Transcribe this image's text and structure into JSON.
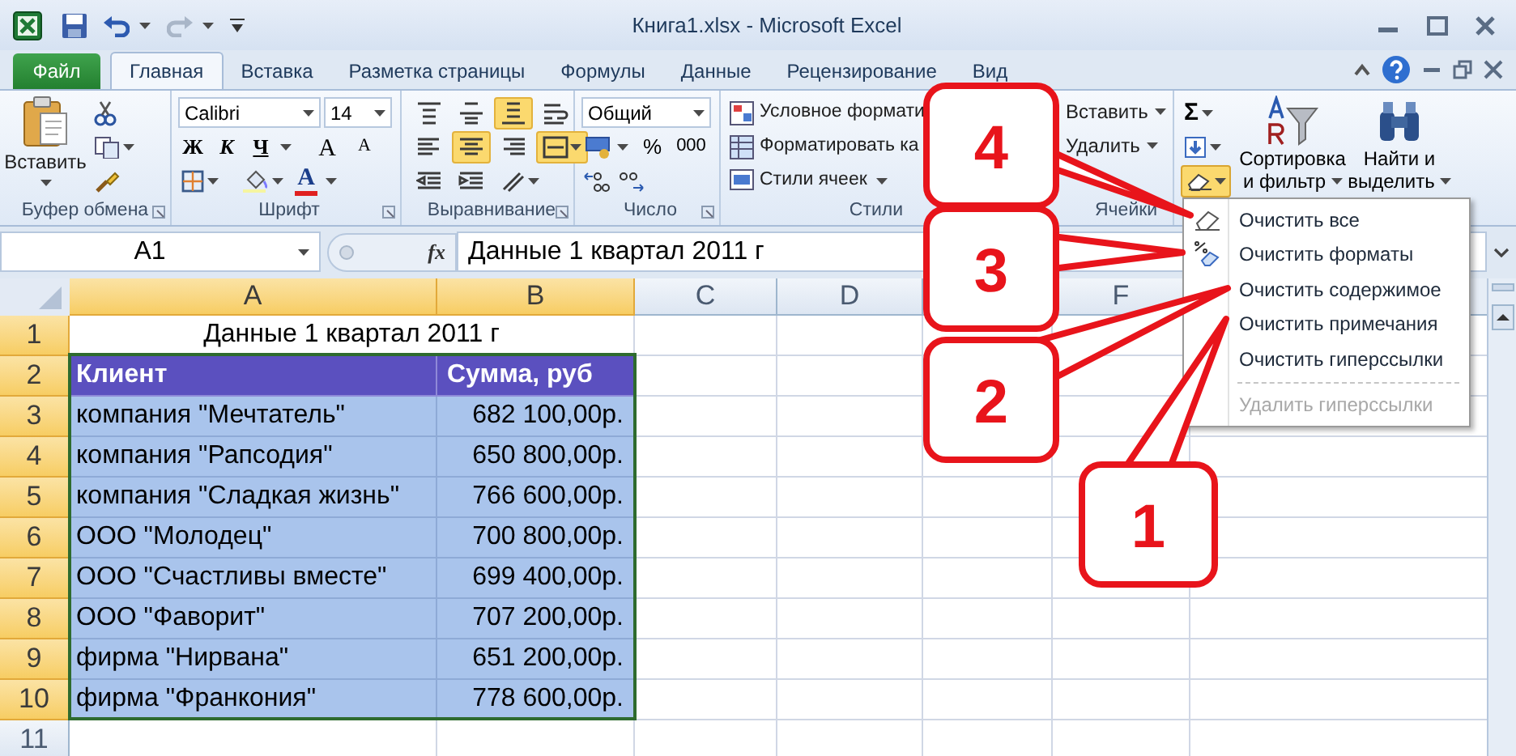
{
  "window": {
    "title": "Книга1.xlsx - Microsoft Excel"
  },
  "tabs": [
    {
      "label": "Файл",
      "kind": "file",
      "selected": false
    },
    {
      "label": "Главная",
      "kind": "tab",
      "selected": true
    },
    {
      "label": "Вставка",
      "kind": "tab",
      "selected": false
    },
    {
      "label": "Разметка страницы",
      "kind": "tab",
      "selected": false
    },
    {
      "label": "Формулы",
      "kind": "tab",
      "selected": false
    },
    {
      "label": "Данные",
      "kind": "tab",
      "selected": false
    },
    {
      "label": "Рецензирование",
      "kind": "tab",
      "selected": false
    },
    {
      "label": "Вид",
      "kind": "tab",
      "selected": false
    }
  ],
  "ribbon": {
    "clipboard": {
      "paste": "Вставить",
      "label": "Буфер обмена"
    },
    "font": {
      "name": "Calibri",
      "size": "14",
      "bold": "Ж",
      "italic": "К",
      "underline": "Ч",
      "grow": "A",
      "shrink": "A",
      "font_color_button": "A",
      "label": "Шрифт"
    },
    "alignment": {
      "label": "Выравнивание",
      "buttons": [
        {
          "kind": "top",
          "selected": false
        },
        {
          "kind": "middle",
          "selected": false
        },
        {
          "kind": "bottom",
          "selected": true
        },
        {
          "kind": "wrap",
          "selected": false
        },
        {
          "kind": "left",
          "selected": false
        },
        {
          "kind": "center",
          "selected": true
        },
        {
          "kind": "right",
          "selected": false
        },
        {
          "kind": "merge",
          "selected": true
        },
        {
          "kind": "outdent",
          "selected": false
        },
        {
          "kind": "indent",
          "selected": false
        },
        {
          "kind": "orientation",
          "selected": false
        }
      ]
    },
    "number": {
      "format": "Общий",
      "percent": "%",
      "thousands": "000",
      "label": "Число"
    },
    "styles": {
      "label": "Стили",
      "items": [
        {
          "label": "Условное формати",
          "menu": false
        },
        {
          "label": "Форматировать ка",
          "menu": false
        },
        {
          "label": "Стили ячеек",
          "menu": true
        }
      ]
    },
    "cells": {
      "label": "Ячейки",
      "items": [
        "Вставить",
        "Удалить"
      ]
    },
    "editing": {
      "sum": "Σ",
      "clear": {
        "expanded": true
      },
      "sort": [
        "Сортировка",
        "и фильтр"
      ],
      "find": [
        "Найти и",
        "выделить"
      ]
    }
  },
  "formula_bar": {
    "name_box": "A1",
    "function_button": "fx",
    "formula": "Данные 1 квартал 2011 г"
  },
  "sheet": {
    "columns": [
      {
        "label": "A",
        "selected": true
      },
      {
        "label": "B",
        "selected": true
      },
      {
        "label": "C",
        "selected": false
      },
      {
        "label": "D",
        "selected": false
      },
      {
        "label": "F",
        "selected": false
      }
    ],
    "row_headers": [
      {
        "label": "1",
        "selected": true
      },
      {
        "label": "2",
        "selected": true
      },
      {
        "label": "3",
        "selected": true
      },
      {
        "label": "4",
        "selected": true
      },
      {
        "label": "5",
        "selected": true
      },
      {
        "label": "6",
        "selected": true
      },
      {
        "label": "7",
        "selected": true
      },
      {
        "label": "8",
        "selected": true
      },
      {
        "label": "9",
        "selected": true
      },
      {
        "label": "10",
        "selected": true
      },
      {
        "label": "11",
        "selected": false
      }
    ],
    "title": "Данные 1 квартал 2011 г",
    "header": [
      "Клиент",
      "Сумма, руб"
    ],
    "rows": [
      [
        "компания \"Мечтатель\"",
        "682 100,00р."
      ],
      [
        "компания \"Рапсодия\"",
        "650 800,00р."
      ],
      [
        "компания \"Сладкая жизнь\"",
        "766 600,00р."
      ],
      [
        "ООО \"Молодец\"",
        "700 800,00р."
      ],
      [
        "ООО \"Счастливы вместе\"",
        "699 400,00р."
      ],
      [
        "ООО \"Фаворит\"",
        "707 200,00р."
      ],
      [
        "фирма \"Нирвана\"",
        "651 200,00р."
      ],
      [
        "фирма \"Франкония\"",
        "778 600,00р."
      ]
    ]
  },
  "clear_menu": {
    "items": [
      {
        "label": "Очистить все",
        "kind": "eraser",
        "disabled": false
      },
      {
        "label": "Очистить форматы",
        "kind": "format_eraser",
        "disabled": false
      },
      {
        "label": "Очистить содержимое",
        "kind": "none",
        "disabled": false
      },
      {
        "label": "Очистить примечания",
        "kind": "none",
        "disabled": false
      },
      {
        "label": "Очистить гиперссылки",
        "kind": "none",
        "disabled": false
      },
      {
        "label": "Удалить гиперссылки",
        "kind": "none",
        "disabled": true
      }
    ]
  },
  "callouts": [
    {
      "label": "4"
    },
    {
      "label": "3"
    },
    {
      "label": "2"
    },
    {
      "label": "1"
    }
  ]
}
